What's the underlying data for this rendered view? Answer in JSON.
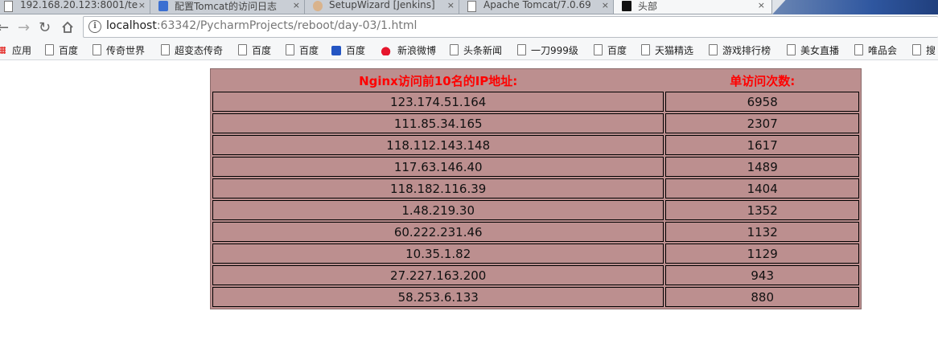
{
  "browser": {
    "tabs": [
      {
        "title": "192.168.20.123:8001/te",
        "active": false
      },
      {
        "title": "配置Tomcat的访问日志",
        "active": false
      },
      {
        "title": "SetupWizard [Jenkins]",
        "active": false
      },
      {
        "title": "Apache Tomcat/7.0.69",
        "active": false
      },
      {
        "title": "头部",
        "active": true
      }
    ],
    "close_glyph": "×",
    "url_host": "localhost",
    "url_rest": ":63342/PycharmProjects/reboot/day-03/1.html",
    "bookmarks": [
      "应用",
      "百度",
      "传奇世界",
      "超变态传奇",
      "百度",
      "百度",
      "百度",
      "新浪微博",
      "头条新闻",
      "一刀999级",
      "百度",
      "天猫精选",
      "游戏排行榜",
      "美女直播",
      "唯品会",
      "搜"
    ]
  },
  "table": {
    "headers": [
      "Nginx访问前10名的IP地址:",
      "单访问次数:"
    ],
    "rows": [
      [
        "123.174.51.164",
        "6958"
      ],
      [
        "111.85.34.165",
        "2307"
      ],
      [
        "118.112.143.148",
        "1617"
      ],
      [
        "117.63.146.40",
        "1489"
      ],
      [
        "118.182.116.39",
        "1404"
      ],
      [
        "1.48.219.30",
        "1352"
      ],
      [
        "60.222.231.46",
        "1132"
      ],
      [
        "10.35.1.82",
        "1129"
      ],
      [
        "27.227.163.200",
        "943"
      ],
      [
        "58.253.6.133",
        "880"
      ]
    ]
  },
  "colors": {
    "table_bg": "#bc8f8f",
    "header_text": "#ff0000"
  }
}
